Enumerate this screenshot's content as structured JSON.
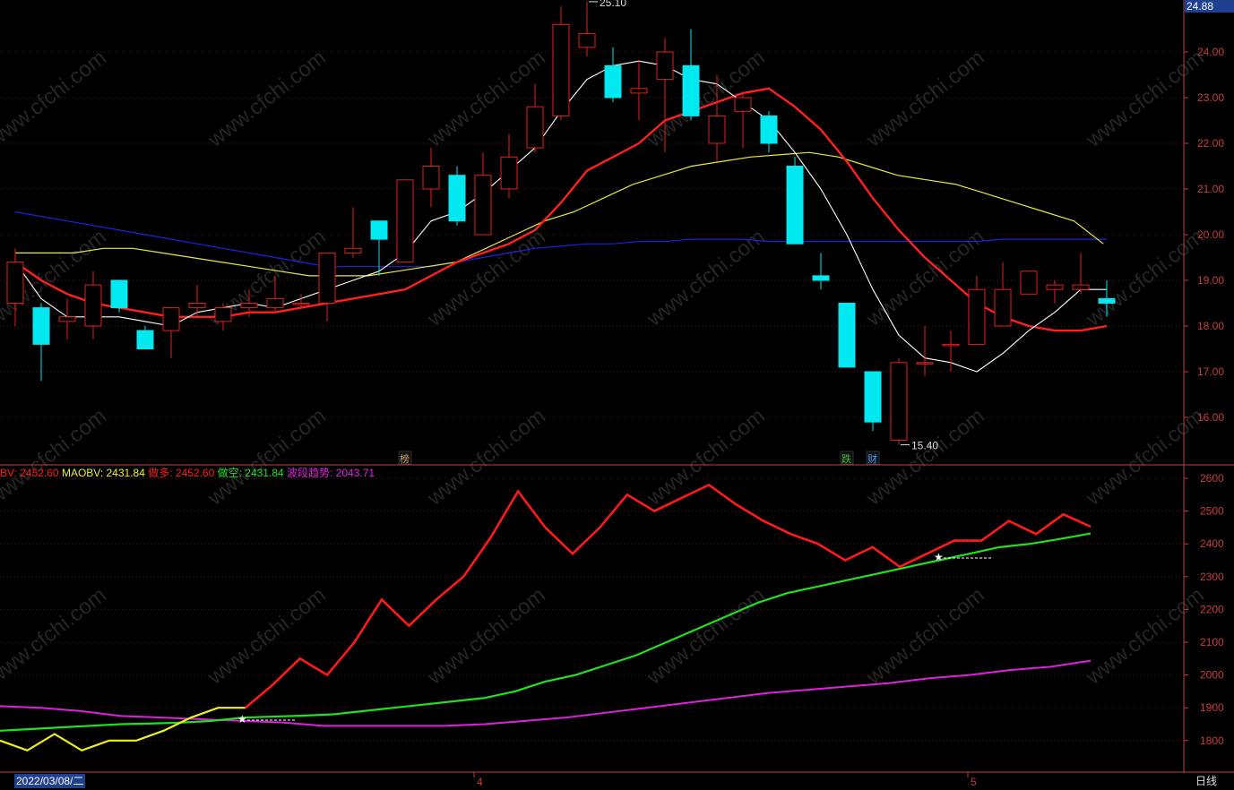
{
  "current_price": "24.88",
  "cursor_date": "2022/03/08/二",
  "period": "日线",
  "x_month_labels": [
    {
      "label": "4",
      "index": 18
    },
    {
      "label": "5",
      "index": 37
    }
  ],
  "colors": {
    "up": "#e02020",
    "down": "#00e8f0",
    "ma5": "#ffffff",
    "ma10": "#ff2020",
    "ma20": "#e8e840",
    "ma60": "#2020e0",
    "obv_up": "#ff1a1a",
    "obv_down": "#f0f020",
    "maobv": "#20e020",
    "trend": "#e020e0",
    "axis": "#c83c3c"
  },
  "chart_data": [
    {
      "type": "candlestick",
      "ylim": [
        15.0,
        25.2
      ],
      "yticks": [
        "16.00",
        "17.00",
        "18.00",
        "19.00",
        "20.00",
        "21.00",
        "22.00",
        "23.00",
        "24.00"
      ],
      "annotations": [
        {
          "text": "25.10",
          "index": 22,
          "price": 25.1,
          "kind": "high"
        },
        {
          "text": "15.40",
          "index": 34,
          "price": 15.4,
          "kind": "low"
        }
      ],
      "markers": [
        {
          "text": "榜",
          "index": 15
        },
        {
          "text": "跌",
          "index": 32
        },
        {
          "text": "财",
          "index": 33
        }
      ],
      "ohlc": [
        [
          18.5,
          19.7,
          18.0,
          19.4
        ],
        [
          18.4,
          18.5,
          16.8,
          17.6
        ],
        [
          18.1,
          18.6,
          17.7,
          18.2
        ],
        [
          18.0,
          19.2,
          17.7,
          18.9
        ],
        [
          19.0,
          19.0,
          18.3,
          18.4
        ],
        [
          17.9,
          18.0,
          17.5,
          17.5
        ],
        [
          17.9,
          18.4,
          17.3,
          18.4
        ],
        [
          18.4,
          18.9,
          18.2,
          18.5
        ],
        [
          18.1,
          18.5,
          17.9,
          18.4
        ],
        [
          18.4,
          18.8,
          18.2,
          18.5
        ],
        [
          18.4,
          19.1,
          18.3,
          18.6
        ],
        [
          18.5,
          18.7,
          18.4,
          18.5
        ],
        [
          18.5,
          19.6,
          18.1,
          19.6
        ],
        [
          19.6,
          20.6,
          19.5,
          19.7
        ],
        [
          20.3,
          20.3,
          19.1,
          19.9
        ],
        [
          19.4,
          21.2,
          19.4,
          21.2
        ],
        [
          21.0,
          21.9,
          20.6,
          21.5
        ],
        [
          21.3,
          21.5,
          20.2,
          20.3
        ],
        [
          20.0,
          21.8,
          20.0,
          21.3
        ],
        [
          21.0,
          22.2,
          20.8,
          21.7
        ],
        [
          21.9,
          23.3,
          21.8,
          22.8
        ],
        [
          22.6,
          25.0,
          22.5,
          24.6
        ],
        [
          24.1,
          25.1,
          23.9,
          24.4
        ],
        [
          23.7,
          24.1,
          22.9,
          23.0
        ],
        [
          23.1,
          23.8,
          22.5,
          23.2
        ],
        [
          23.4,
          24.3,
          21.8,
          24.0
        ],
        [
          23.7,
          24.5,
          22.5,
          22.6
        ],
        [
          22.0,
          23.5,
          21.6,
          22.6
        ],
        [
          22.7,
          23.1,
          21.9,
          23.0
        ],
        [
          22.6,
          22.7,
          21.8,
          22.0
        ],
        [
          21.5,
          21.7,
          19.8,
          19.8
        ],
        [
          19.1,
          19.6,
          18.8,
          19.0
        ],
        [
          18.5,
          18.5,
          17.1,
          17.1
        ],
        [
          17.0,
          17.0,
          15.7,
          15.9
        ],
        [
          15.5,
          17.3,
          15.4,
          17.2
        ],
        [
          17.2,
          18.0,
          16.9,
          17.2
        ],
        [
          17.6,
          17.9,
          17.0,
          17.6
        ],
        [
          17.6,
          19.1,
          17.6,
          18.8
        ],
        [
          18.0,
          19.4,
          18.0,
          18.8
        ],
        [
          18.7,
          19.2,
          18.7,
          19.2
        ],
        [
          18.8,
          19.0,
          18.5,
          18.9
        ],
        [
          18.8,
          19.6,
          18.7,
          18.9
        ],
        [
          18.6,
          19.0,
          18.2,
          18.5
        ]
      ],
      "series": [
        {
          "key": "ma5",
          "values": [
            19.4,
            18.6,
            18.2,
            18.2,
            18.2,
            18.1,
            18.0,
            18.3,
            18.4,
            18.5,
            18.4,
            18.6,
            18.8,
            19.0,
            19.2,
            19.6,
            20.3,
            20.5,
            20.9,
            21.4,
            21.9,
            22.7,
            23.4,
            23.7,
            23.8,
            23.7,
            23.4,
            23.3,
            22.9,
            22.5,
            21.8,
            21.0,
            20.0,
            18.8,
            17.8,
            17.3,
            17.2,
            17.0,
            17.4,
            17.9,
            18.3,
            18.8,
            18.8
          ]
        },
        {
          "key": "ma10",
          "values": [
            19.4,
            19.0,
            18.7,
            18.5,
            18.4,
            18.3,
            18.2,
            18.2,
            18.2,
            18.3,
            18.3,
            18.4,
            18.5,
            18.6,
            18.7,
            18.8,
            19.1,
            19.4,
            19.6,
            19.8,
            20.1,
            20.7,
            21.4,
            21.7,
            22.0,
            22.5,
            22.7,
            22.9,
            23.1,
            23.2,
            22.8,
            22.3,
            21.6,
            20.8,
            20.1,
            19.5,
            19.0,
            18.5,
            18.2,
            18.0,
            17.9,
            17.9,
            18.0
          ]
        },
        {
          "key": "ma20",
          "values": [
            19.6,
            19.6,
            19.6,
            19.7,
            19.7,
            19.6,
            19.5,
            19.4,
            19.3,
            19.2,
            19.1,
            19.1,
            19.1,
            19.2,
            19.3,
            19.4,
            19.7,
            20.0,
            20.3,
            20.5,
            20.8,
            21.1,
            21.3,
            21.5,
            21.6,
            21.7,
            21.75,
            21.8,
            21.7,
            21.5,
            21.3,
            21.2,
            21.1,
            20.9,
            20.7,
            20.5,
            20.3,
            19.8
          ]
        },
        {
          "key": "ma60",
          "values": [
            20.5,
            20.4,
            20.3,
            20.2,
            20.1,
            20.0,
            19.9,
            19.8,
            19.7,
            19.6,
            19.5,
            19.4,
            19.3,
            19.3,
            19.3,
            19.3,
            19.3,
            19.4,
            19.5,
            19.6,
            19.7,
            19.75,
            19.8,
            19.8,
            19.85,
            19.85,
            19.9,
            19.9,
            19.9,
            19.85,
            19.85,
            19.85,
            19.85,
            19.85,
            19.85,
            19.85,
            19.85,
            19.85,
            19.9,
            19.9,
            19.9,
            19.9,
            19.9
          ]
        }
      ]
    },
    {
      "type": "line",
      "ylim": [
        1720,
        2640
      ],
      "yticks": [
        "1800",
        "1900",
        "2000",
        "2100",
        "2200",
        "2300",
        "2400",
        "2500",
        "2600"
      ],
      "labels": [
        {
          "text": "BV: 2452.60",
          "color": "obv_up"
        },
        {
          "text": "MAOBV: 2431.84",
          "color": "obv_down"
        },
        {
          "text": "做多: 2452.60",
          "color": "obv_up"
        },
        {
          "text": "做空: 2431.84",
          "color": "maobv"
        },
        {
          "text": "波段趋势: 2043.71",
          "color": "trend"
        }
      ],
      "series": [
        {
          "key": "obv",
          "values": [
            1800,
            1770,
            1820,
            1770,
            1800,
            1800,
            1830,
            1870,
            1900,
            1900,
            1970,
            2050,
            2000,
            2100,
            2230,
            2150,
            2230,
            2300,
            2420,
            2560,
            2450,
            2370,
            2450,
            2550,
            2500,
            2540,
            2580,
            2520,
            2470,
            2430,
            2400,
            2350,
            2390,
            2330,
            2370,
            2410,
            2410,
            2470,
            2430,
            2490,
            2452.6
          ]
        },
        {
          "key": "maobv",
          "values": [
            1830,
            1835,
            1840,
            1845,
            1850,
            1852,
            1855,
            1860,
            1870,
            1873,
            1876,
            1880,
            1890,
            1900,
            1910,
            1920,
            1930,
            1950,
            1980,
            2000,
            2030,
            2060,
            2100,
            2140,
            2180,
            2220,
            2250,
            2270,
            2290,
            2310,
            2330,
            2350,
            2370,
            2390,
            2400,
            2415,
            2431.84
          ]
        },
        {
          "key": "trend",
          "values": [
            1905,
            1900,
            1890,
            1875,
            1870,
            1865,
            1860,
            1855,
            1845,
            1845,
            1845,
            1845,
            1850,
            1860,
            1870,
            1885,
            1900,
            1915,
            1930,
            1945,
            1955,
            1965,
            1975,
            1990,
            2000,
            2015,
            2025,
            2043.71
          ]
        }
      ]
    }
  ]
}
